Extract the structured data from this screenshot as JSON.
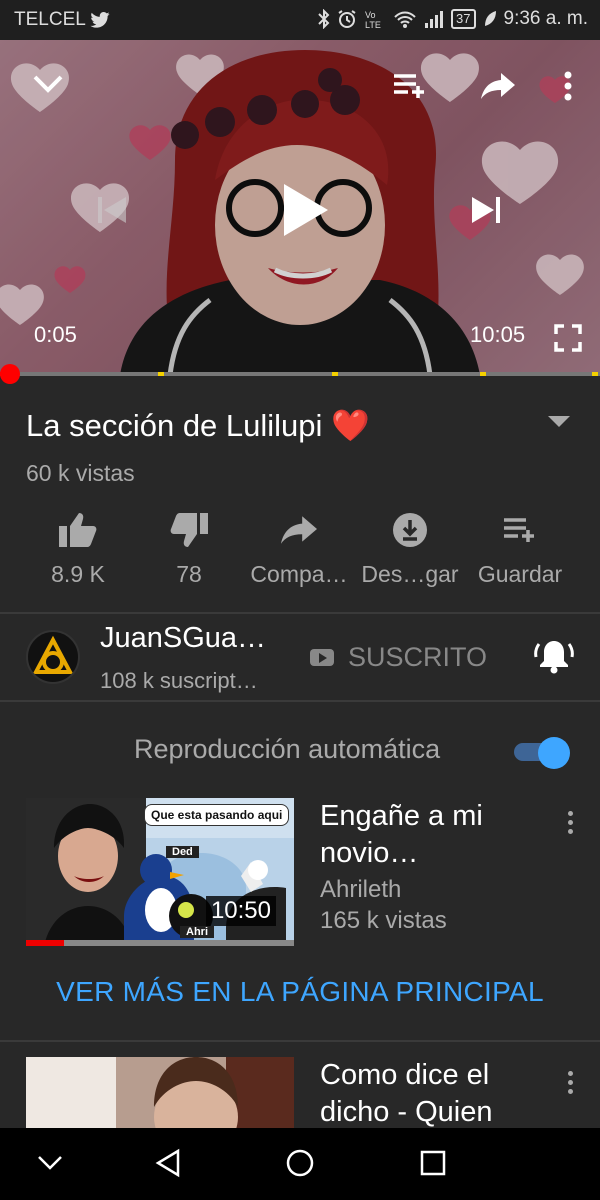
{
  "status_bar": {
    "carrier": "TELCEL",
    "battery": "37",
    "time": "9:36 a. m."
  },
  "player": {
    "elapsed": "0:05",
    "duration": "10:05",
    "progress_fraction": 0.0083
  },
  "video": {
    "title": "La sección de Lulilupi",
    "title_emoji": "❤️",
    "views": "60 k vistas"
  },
  "actions": [
    {
      "label": "8.9 K",
      "icon": "thumbs-up-icon"
    },
    {
      "label": "78",
      "icon": "thumbs-down-icon"
    },
    {
      "label": "Compa…",
      "icon": "share-icon"
    },
    {
      "label": "Des…gar",
      "icon": "download-icon"
    },
    {
      "label": "Guardar",
      "icon": "save-to-playlist-icon"
    }
  ],
  "channel": {
    "name": "JuanSGua…",
    "subscribers": "108 k suscript…",
    "subscribed_label": "SUSCRITO"
  },
  "autoplay": {
    "label": "Reproducción automática",
    "enabled": true
  },
  "up_next": [
    {
      "title": "Engañe a mi novio…",
      "channel": "Ahrileth",
      "views": "165 k vistas",
      "duration": "10:50",
      "watched_fraction": 0.14,
      "thumb_bubble": "Que esta pasando aqui",
      "thumb_tag_1": "Ded",
      "thumb_tag_2": "Ahri"
    },
    {
      "title": "Como dice el dicho - Quien"
    }
  ],
  "see_more_label": "VER MÁS EN LA PÁGINA PRINCIPAL",
  "colors": {
    "accent_blue": "#3ea6ff",
    "progress_red": "#ff0000",
    "background": "#282828"
  }
}
